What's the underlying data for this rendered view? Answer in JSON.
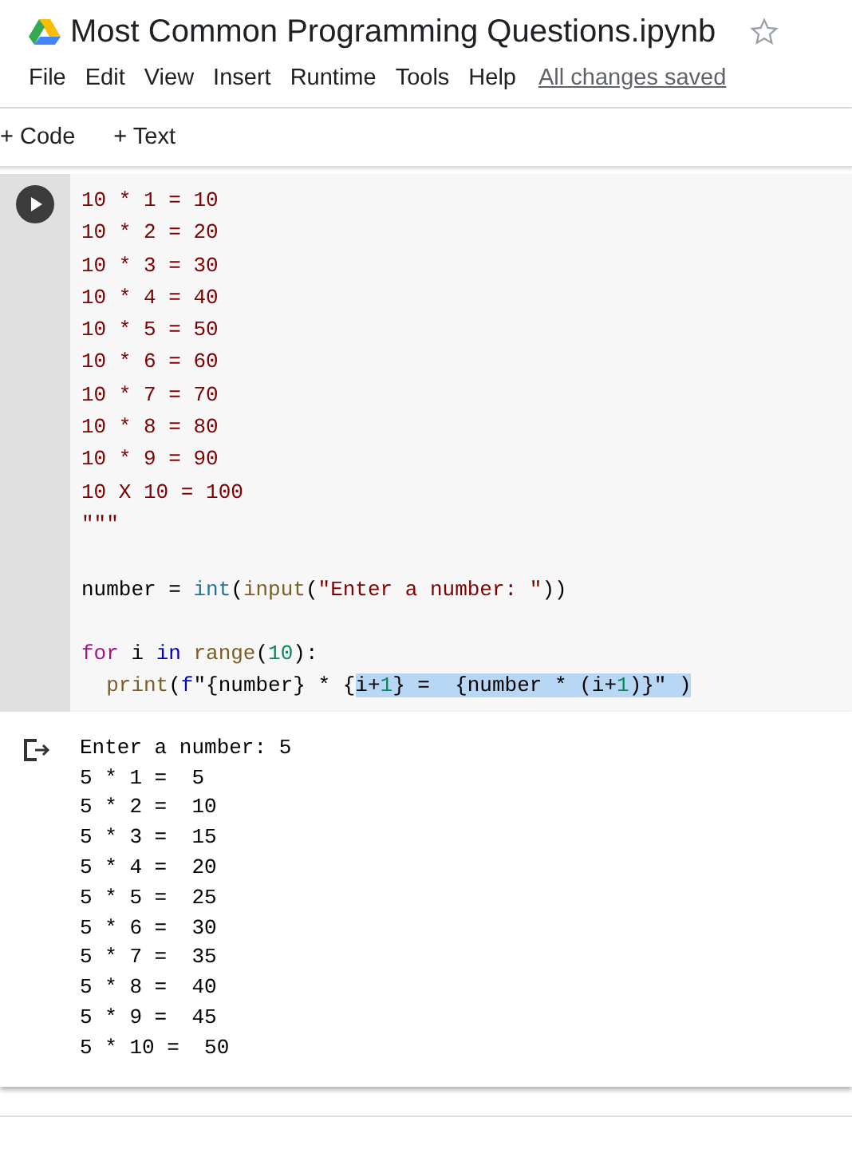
{
  "header": {
    "title": "Most Common Programming Questions.ipynb",
    "starred": false
  },
  "menu": [
    "File",
    "Edit",
    "View",
    "Insert",
    "Runtime",
    "Tools",
    "Help"
  ],
  "save_status": "All changes saved",
  "toolbar": [
    {
      "icon": "+",
      "label": "Code"
    },
    {
      "icon": "+",
      "label": "Text"
    }
  ],
  "code_cell": {
    "lines": [
      {
        "kind": "code",
        "tokens": [
          {
            "kind": "string",
            "text": "10 * 1 = 10"
          }
        ]
      },
      {
        "kind": "code",
        "tokens": [
          {
            "kind": "string",
            "text": "10 * 2 = 20"
          }
        ]
      },
      {
        "kind": "code",
        "tokens": [
          {
            "kind": "string",
            "text": "10 * 3 = 30"
          }
        ]
      },
      {
        "kind": "code",
        "tokens": [
          {
            "kind": "string",
            "text": "10 * 4 = 40"
          }
        ]
      },
      {
        "kind": "code",
        "tokens": [
          {
            "kind": "string",
            "text": "10 * 5 = 50"
          }
        ]
      },
      {
        "kind": "code",
        "tokens": [
          {
            "kind": "string",
            "text": "10 * 6 = 60"
          }
        ]
      },
      {
        "kind": "code",
        "tokens": [
          {
            "kind": "string",
            "text": "10 * 7 = 70"
          }
        ]
      },
      {
        "kind": "code",
        "tokens": [
          {
            "kind": "string",
            "text": "10 * 8 = 80"
          }
        ]
      },
      {
        "kind": "code",
        "tokens": [
          {
            "kind": "string",
            "text": "10 * 9 = 90"
          }
        ]
      },
      {
        "kind": "code",
        "tokens": [
          {
            "kind": "string",
            "text": "10 X 10 = 100"
          }
        ]
      },
      {
        "kind": "code",
        "tokens": [
          {
            "kind": "string",
            "text": "\"\"\""
          }
        ]
      },
      {
        "kind": "blank"
      },
      {
        "kind": "code",
        "tokens": [
          {
            "kind": "plain",
            "text": "number = "
          },
          {
            "kind": "builtin",
            "text": "int"
          },
          {
            "kind": "plain",
            "text": "("
          },
          {
            "kind": "function",
            "text": "input"
          },
          {
            "kind": "plain",
            "text": "("
          },
          {
            "kind": "string",
            "text": "\"Enter a number: \""
          },
          {
            "kind": "plain",
            "text": "))"
          }
        ]
      },
      {
        "kind": "blank"
      },
      {
        "kind": "code",
        "tokens": [
          {
            "kind": "keyword",
            "text": "for"
          },
          {
            "kind": "plain",
            "text": " i "
          },
          {
            "kind": "operator",
            "text": "in "
          },
          {
            "kind": "function",
            "text": "range"
          },
          {
            "kind": "plain",
            "text": "("
          },
          {
            "kind": "number",
            "text": "10"
          },
          {
            "kind": "plain",
            "text": "):"
          }
        ]
      },
      {
        "kind": "code",
        "tokens": [
          {
            "kind": "function",
            "text": "  print",
            "selected": false
          },
          {
            "kind": "plain",
            "text": "(",
            "selected": false
          },
          {
            "kind": "operator",
            "text": "f",
            "selected": false
          },
          {
            "kind": "plain",
            "text": "\"{number} * {",
            "selected": false
          },
          {
            "kind": "plain",
            "text": "i+",
            "selected": true
          },
          {
            "kind": "number",
            "text": "1",
            "selected": true
          },
          {
            "kind": "plain",
            "text": "} =  {number * (i+",
            "selected": true
          },
          {
            "kind": "number",
            "text": "1",
            "selected": true
          },
          {
            "kind": "plain",
            "text": ")}\" )",
            "selected": true
          }
        ]
      }
    ]
  },
  "output": [
    "Enter a number: 5",
    "5 * 1 =  5",
    "5 * 2 =  10",
    "5 * 3 =  15",
    "5 * 4 =  20",
    "5 * 5 =  25",
    "5 * 6 =  30",
    "5 * 7 =  35",
    "5 * 8 =  40",
    "5 * 9 =  45",
    "5 * 10 =  50"
  ]
}
